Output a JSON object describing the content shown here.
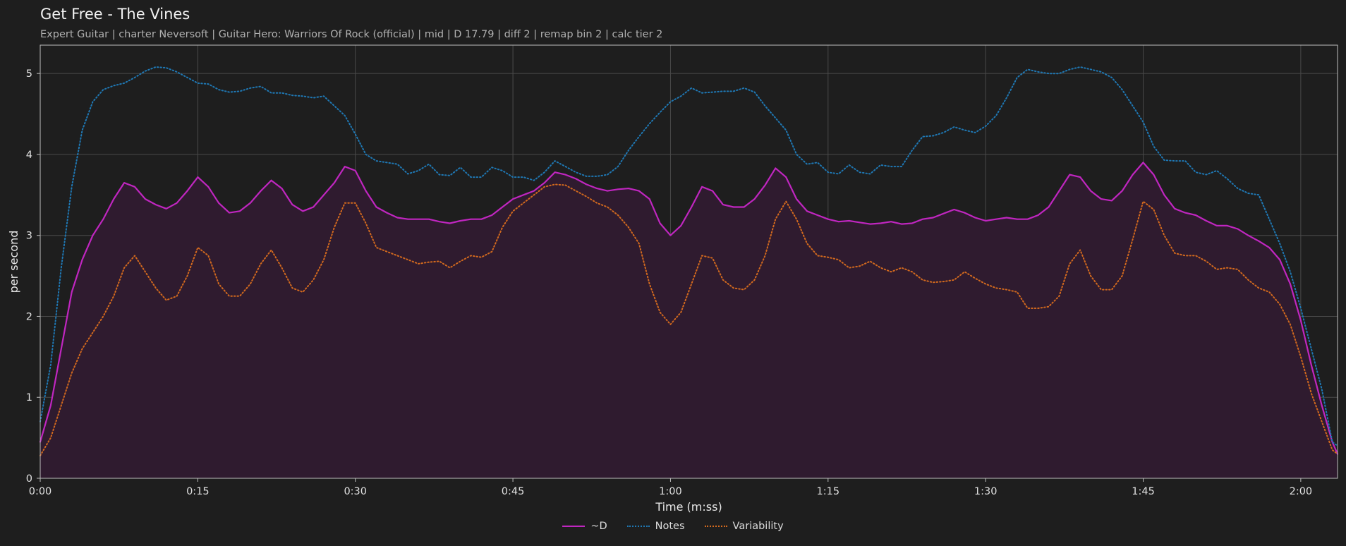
{
  "colors": {
    "background": "#1e1e1e",
    "plot_bg": "#1e1e1e",
    "grid": "#4a4a4a",
    "axis": "#bdbdbd",
    "d_line": "#c026c0",
    "d_fill": "#2f1b2f",
    "notes": "#1f78b4",
    "variability": "#d2691e"
  },
  "chart_data": {
    "type": "line",
    "title": "Get Free - The Vines",
    "subtitle": "Expert Guitar  |  charter Neversoft  |  Guitar Hero: Warriors Of Rock (official)  |  mid  |  D 17.79  |  diff 2  |  remap bin 2  |  calc tier 2",
    "xlabel": "Time (m:ss)",
    "ylabel": "per second",
    "xlim": [
      0,
      123.5
    ],
    "ylim": [
      0,
      5.35
    ],
    "x_ticks": [
      0,
      15,
      30,
      45,
      60,
      75,
      90,
      105,
      120
    ],
    "x_tick_labels": [
      "0:00",
      "0:15",
      "0:30",
      "0:45",
      "1:00",
      "1:15",
      "1:30",
      "1:45",
      "2:00"
    ],
    "y_ticks": [
      0,
      1,
      2,
      3,
      4,
      5
    ],
    "y_tick_labels": [
      "0",
      "1",
      "2",
      "3",
      "4",
      "5"
    ],
    "grid": true,
    "legend_position": "bottom-center",
    "x": [
      0,
      1,
      2,
      3,
      4,
      5,
      6,
      7,
      8,
      9,
      10,
      11,
      12,
      13,
      14,
      15,
      16,
      17,
      18,
      19,
      20,
      21,
      22,
      23,
      24,
      25,
      26,
      27,
      28,
      29,
      30,
      31,
      32,
      33,
      34,
      35,
      36,
      37,
      38,
      39,
      40,
      41,
      42,
      43,
      44,
      45,
      46,
      47,
      48,
      49,
      50,
      51,
      52,
      53,
      54,
      55,
      56,
      57,
      58,
      59,
      60,
      61,
      62,
      63,
      64,
      65,
      66,
      67,
      68,
      69,
      70,
      71,
      72,
      73,
      74,
      75,
      76,
      77,
      78,
      79,
      80,
      81,
      82,
      83,
      84,
      85,
      86,
      87,
      88,
      89,
      90,
      91,
      92,
      93,
      94,
      95,
      96,
      97,
      98,
      99,
      100,
      101,
      102,
      103,
      104,
      105,
      106,
      107,
      108,
      109,
      110,
      111,
      112,
      113,
      114,
      115,
      116,
      117,
      118,
      119,
      120,
      121,
      122,
      123,
      123.5
    ],
    "series": [
      {
        "name": "~D",
        "style": "solid",
        "fill": true,
        "values": [
          0.45,
          0.9,
          1.6,
          2.3,
          2.7,
          3.0,
          3.2,
          3.45,
          3.65,
          3.6,
          3.45,
          3.38,
          3.33,
          3.4,
          3.55,
          3.72,
          3.6,
          3.4,
          3.28,
          3.3,
          3.4,
          3.55,
          3.68,
          3.58,
          3.38,
          3.3,
          3.35,
          3.5,
          3.65,
          3.85,
          3.8,
          3.55,
          3.35,
          3.28,
          3.22,
          3.2,
          3.2,
          3.2,
          3.17,
          3.15,
          3.18,
          3.2,
          3.2,
          3.25,
          3.35,
          3.45,
          3.5,
          3.55,
          3.65,
          3.78,
          3.75,
          3.7,
          3.63,
          3.58,
          3.55,
          3.57,
          3.58,
          3.55,
          3.45,
          3.15,
          3.0,
          3.12,
          3.35,
          3.6,
          3.55,
          3.38,
          3.35,
          3.35,
          3.45,
          3.62,
          3.83,
          3.72,
          3.45,
          3.3,
          3.25,
          3.2,
          3.17,
          3.18,
          3.16,
          3.14,
          3.15,
          3.17,
          3.14,
          3.15,
          3.2,
          3.22,
          3.27,
          3.32,
          3.28,
          3.22,
          3.18,
          3.2,
          3.22,
          3.2,
          3.2,
          3.25,
          3.35,
          3.55,
          3.75,
          3.72,
          3.55,
          3.45,
          3.43,
          3.55,
          3.75,
          3.9,
          3.75,
          3.5,
          3.33,
          3.28,
          3.25,
          3.18,
          3.12,
          3.12,
          3.08,
          3.0,
          2.93,
          2.85,
          2.7,
          2.4,
          1.95,
          1.4,
          0.9,
          0.45,
          0.3
        ]
      },
      {
        "name": "Notes",
        "style": "dotted",
        "fill": false,
        "values": [
          0.7,
          1.4,
          2.6,
          3.6,
          4.3,
          4.65,
          4.8,
          4.85,
          4.88,
          4.95,
          5.03,
          5.08,
          5.07,
          5.02,
          4.95,
          4.88,
          4.87,
          4.8,
          4.77,
          4.78,
          4.82,
          4.84,
          4.76,
          4.76,
          4.73,
          4.72,
          4.7,
          4.72,
          4.6,
          4.48,
          4.25,
          4.0,
          3.92,
          3.9,
          3.88,
          3.76,
          3.8,
          3.88,
          3.75,
          3.74,
          3.84,
          3.72,
          3.72,
          3.84,
          3.8,
          3.72,
          3.72,
          3.68,
          3.78,
          3.92,
          3.85,
          3.78,
          3.73,
          3.73,
          3.75,
          3.85,
          4.05,
          4.22,
          4.38,
          4.52,
          4.65,
          4.72,
          4.82,
          4.76,
          4.77,
          4.78,
          4.78,
          4.82,
          4.77,
          4.6,
          4.45,
          4.3,
          4.0,
          3.88,
          3.9,
          3.78,
          3.76,
          3.87,
          3.78,
          3.76,
          3.87,
          3.85,
          3.85,
          4.05,
          4.22,
          4.23,
          4.27,
          4.34,
          4.3,
          4.27,
          4.35,
          4.48,
          4.7,
          4.95,
          5.05,
          5.02,
          5.0,
          5.0,
          5.05,
          5.08,
          5.05,
          5.02,
          4.95,
          4.8,
          4.6,
          4.4,
          4.1,
          3.93,
          3.92,
          3.92,
          3.78,
          3.75,
          3.8,
          3.7,
          3.58,
          3.52,
          3.5,
          3.2,
          2.9,
          2.55,
          2.1,
          1.6,
          1.1,
          0.45,
          0.4
        ]
      },
      {
        "name": "Variability",
        "style": "dotted",
        "fill": false,
        "values": [
          0.28,
          0.5,
          0.9,
          1.3,
          1.6,
          1.8,
          2.0,
          2.25,
          2.6,
          2.75,
          2.55,
          2.35,
          2.2,
          2.25,
          2.5,
          2.85,
          2.75,
          2.4,
          2.25,
          2.25,
          2.4,
          2.65,
          2.82,
          2.6,
          2.35,
          2.3,
          2.45,
          2.7,
          3.1,
          3.4,
          3.4,
          3.15,
          2.85,
          2.8,
          2.75,
          2.7,
          2.65,
          2.67,
          2.68,
          2.6,
          2.68,
          2.75,
          2.73,
          2.8,
          3.1,
          3.3,
          3.4,
          3.5,
          3.6,
          3.63,
          3.62,
          3.55,
          3.48,
          3.4,
          3.35,
          3.25,
          3.1,
          2.9,
          2.4,
          2.05,
          1.9,
          2.05,
          2.4,
          2.75,
          2.72,
          2.45,
          2.35,
          2.33,
          2.45,
          2.75,
          3.2,
          3.42,
          3.2,
          2.9,
          2.75,
          2.73,
          2.7,
          2.6,
          2.62,
          2.68,
          2.6,
          2.55,
          2.6,
          2.55,
          2.45,
          2.42,
          2.43,
          2.45,
          2.55,
          2.47,
          2.4,
          2.35,
          2.33,
          2.3,
          2.1,
          2.1,
          2.12,
          2.25,
          2.65,
          2.82,
          2.5,
          2.33,
          2.33,
          2.5,
          2.95,
          3.42,
          3.32,
          3.0,
          2.78,
          2.75,
          2.75,
          2.68,
          2.58,
          2.6,
          2.58,
          2.45,
          2.35,
          2.3,
          2.15,
          1.9,
          1.5,
          1.05,
          0.7,
          0.35,
          0.3
        ]
      }
    ]
  }
}
